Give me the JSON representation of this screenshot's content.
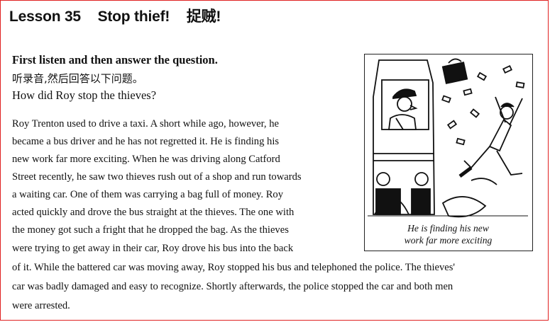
{
  "header": {
    "lesson_number": "Lesson 35",
    "title": "Stop thief!",
    "title_cn": "捉贼!"
  },
  "section": {
    "heading": "First listen and then answer the question.",
    "instruction_cn": "听录音,然后回答以下问题。",
    "question": "How did Roy stop the thieves?"
  },
  "passage": {
    "lines": [
      "Roy Trenton used to drive a taxi. A short while ago, however, he",
      "became a bus driver and he has not regretted it. He is finding his",
      "new work far more exciting. When he was driving along Catford",
      "Street recently, he saw two thieves rush out of a shop and run towards",
      "a waiting car. One of them was carrying a bag full of money. Roy",
      "acted quickly and drove the bus straight at the thieves. The one with",
      "the money got such a fright that he dropped the bag. As the thieves",
      "were trying to get away in their car, Roy drove his bus into the back",
      "of it. While the battered car was moving away, Roy stopped his bus and telephoned the police. The thieves'",
      "car was badly damaged and easy to recognize. Shortly afterwards, the police stopped the car and both men",
      "were arrested."
    ]
  },
  "figure": {
    "caption_line1": "He is finding his new",
    "caption_line2": "work far more exciting"
  }
}
